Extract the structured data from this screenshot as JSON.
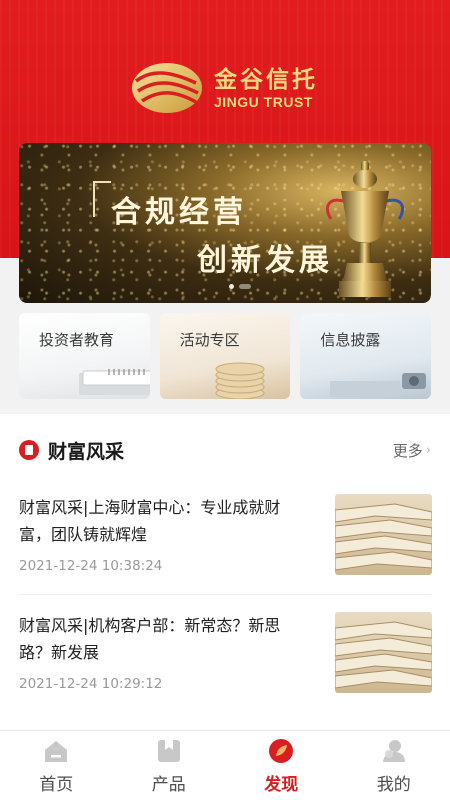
{
  "brand": {
    "name_cn": "金谷信托",
    "name_en": "JINGU TRUST"
  },
  "banner": {
    "line1": "合规经营",
    "line2": "创新发展",
    "slide_count": 2,
    "active_slide": 1
  },
  "quick_links": [
    {
      "label": "投资者教育"
    },
    {
      "label": "活动专区"
    },
    {
      "label": "信息披露"
    }
  ],
  "section": {
    "title": "财富风采",
    "more_label": "更多"
  },
  "articles": [
    {
      "title": "财富风采|上海财富中心：专业成就财富，团队铸就辉煌",
      "date": "2021-12-24 10:38:24",
      "thumb_icon": "paper-stack-photo"
    },
    {
      "title": "财富风采|机构客户部：新常态？新思路？新发展",
      "date": "2021-12-24 10:29:12",
      "thumb_icon": "paper-stack-photo"
    }
  ],
  "tabs": [
    {
      "label": "首页",
      "icon": "home-icon",
      "active": false
    },
    {
      "label": "产品",
      "icon": "product-icon",
      "active": false
    },
    {
      "label": "发现",
      "icon": "discover-icon",
      "active": true
    },
    {
      "label": "我的",
      "icon": "profile-icon",
      "active": false
    }
  ],
  "colors": {
    "brand_red": "#d81e21",
    "gold": "#f4d77e",
    "inactive_icon": "#c8c8c8"
  }
}
